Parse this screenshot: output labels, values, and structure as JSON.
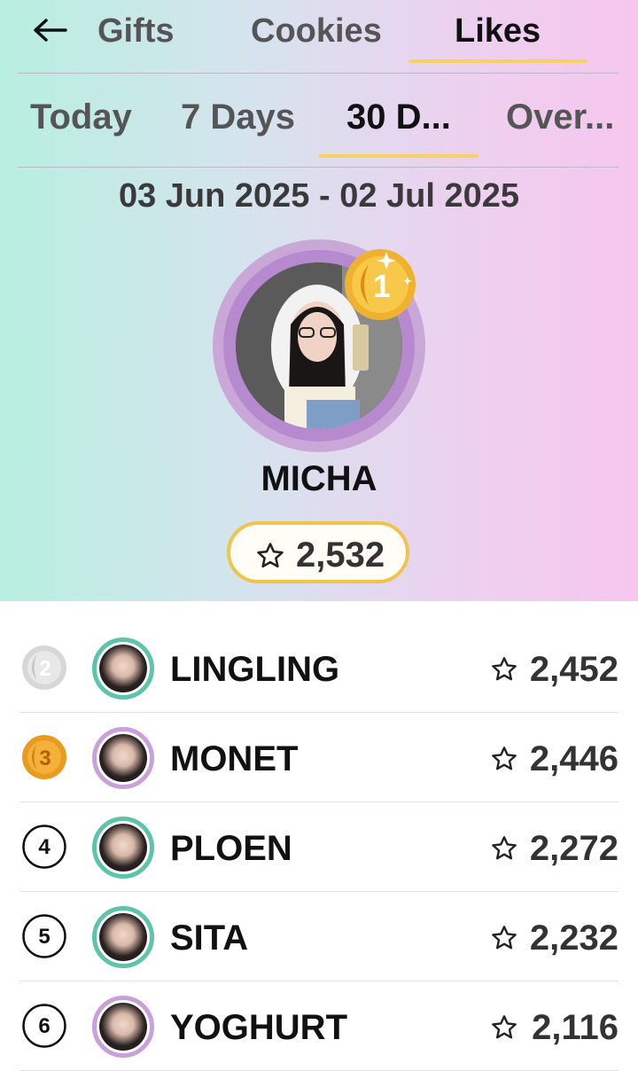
{
  "top_tabs": [
    {
      "label": "Gifts",
      "active": false
    },
    {
      "label": "Cookies",
      "active": false
    },
    {
      "label": "Likes",
      "active": true
    }
  ],
  "period_tabs": [
    {
      "label": "Today",
      "active": false
    },
    {
      "label": "7 Days",
      "active": false
    },
    {
      "label": "30 D...",
      "active": true
    },
    {
      "label": "Over...",
      "active": false
    }
  ],
  "date_range": "03 Jun 2025 - 02 Jul 2025",
  "winner": {
    "rank": "1",
    "name": "MICHA",
    "score": "2,532"
  },
  "leaderboard": [
    {
      "rank": "2",
      "name": "LINGLING",
      "score": "2,452"
    },
    {
      "rank": "3",
      "name": "MONET",
      "score": "2,446"
    },
    {
      "rank": "4",
      "name": "PLOEN",
      "score": "2,272"
    },
    {
      "rank": "5",
      "name": "SITA",
      "score": "2,232"
    },
    {
      "rank": "6",
      "name": "YOGHURT",
      "score": "2,116"
    }
  ],
  "colors": {
    "accent": "#f5d35e",
    "gold": "#f0b12e",
    "silver": "#d0d0d0",
    "bronze": "#e9961f"
  }
}
